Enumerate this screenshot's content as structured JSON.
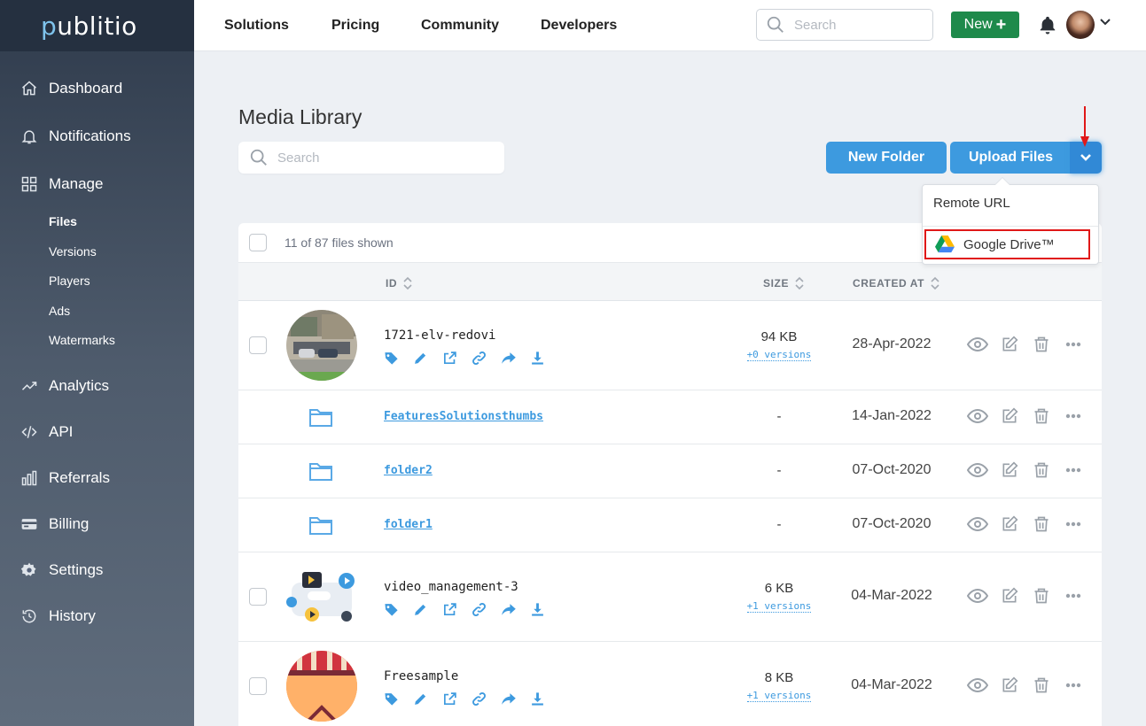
{
  "brand": {
    "logo_p": "p",
    "logo_rest": "ublitio"
  },
  "sidebar": {
    "items": [
      {
        "label": "Dashboard",
        "icon": "home-icon"
      },
      {
        "label": "Notifications",
        "icon": "bell-icon"
      },
      {
        "label": "Manage",
        "icon": "grid-icon"
      },
      {
        "label": "Analytics",
        "icon": "trend-icon"
      },
      {
        "label": "API",
        "icon": "code-icon"
      },
      {
        "label": "Referrals",
        "icon": "bar-chart-icon"
      },
      {
        "label": "Billing",
        "icon": "credit-card-icon"
      },
      {
        "label": "Settings",
        "icon": "gear-icon"
      },
      {
        "label": "History",
        "icon": "history-icon"
      }
    ],
    "sub_items": [
      {
        "label": "Files",
        "active": true
      },
      {
        "label": "Versions"
      },
      {
        "label": "Players"
      },
      {
        "label": "Ads"
      },
      {
        "label": "Watermarks"
      }
    ]
  },
  "topnav": {
    "links": [
      "Solutions",
      "Pricing",
      "Community",
      "Developers"
    ],
    "search_placeholder": "Search",
    "new_label": "New",
    "new_plus": "+"
  },
  "library": {
    "title": "Media Library",
    "search_placeholder": "Search",
    "new_folder_label": "New Folder",
    "upload_label": "Upload Files",
    "dropdown": {
      "remote_url": "Remote URL",
      "google_drive": "Google Drive™"
    },
    "files_shown": "11 of 87 files shown",
    "columns": {
      "id": "ID",
      "size": "SIZE",
      "created_at": "CREATED AT"
    },
    "rows": [
      {
        "type": "file",
        "id": "1721-elv-redovi",
        "size": "94 KB",
        "versions": "+0 versions",
        "created": "28-Apr-2022"
      },
      {
        "type": "folder",
        "id": "FeaturesSolutionsthumbs",
        "size": "-",
        "created": "14-Jan-2022"
      },
      {
        "type": "folder",
        "id": "folder2",
        "size": "-",
        "created": "07-Oct-2020"
      },
      {
        "type": "folder",
        "id": "folder1",
        "size": "-",
        "created": "07-Oct-2020"
      },
      {
        "type": "file",
        "id": "video_management-3",
        "size": "6 KB",
        "versions": "+1 versions",
        "created": "04-Mar-2022"
      },
      {
        "type": "file",
        "id": "Freesample",
        "size": "8 KB",
        "versions": "+1 versions",
        "created": "04-Mar-2022"
      }
    ]
  },
  "colors": {
    "accent": "#3d9adf",
    "new_button": "#1e8a4b",
    "highlight": "#e01818",
    "sidebar_top": "#2f3b4c"
  }
}
